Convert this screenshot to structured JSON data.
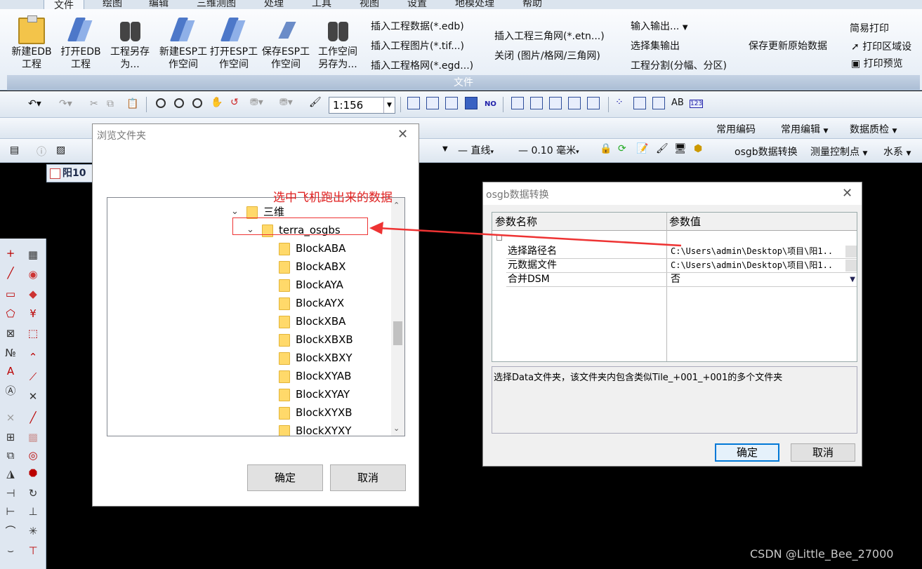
{
  "ribbon": {
    "tabs": [
      "文件",
      "绘图",
      "编辑",
      "三维测图",
      "处理",
      "工具",
      "视图",
      "设置",
      "地模处理",
      "帮助"
    ],
    "active_tab": "文件",
    "big_buttons": [
      {
        "label": "新建EDB\n工程",
        "icon": "clipboard-icon"
      },
      {
        "label": "打开EDB\n工程",
        "icon": "pen-icon"
      },
      {
        "label": "工程另存\n为...",
        "icon": "binoculars-icon"
      },
      {
        "label": "新建ESP工\n作空间",
        "icon": "pen-icon"
      },
      {
        "label": "打开ESP工\n作空间",
        "icon": "pen-icon"
      },
      {
        "label": "保存ESP工\n作空间",
        "icon": "arrow-icon"
      },
      {
        "label": "工作空间\n另存为...",
        "icon": "binoculars-icon"
      }
    ],
    "small_buttons": {
      "insert_edb": "插入工程数据(*.edb)",
      "insert_image": "插入工程图片(*.tif...)",
      "insert_grid": "插入工程格网(*.egd...)",
      "insert_tin": "插入工程三角网(*.etn...)",
      "close_tin": "关闭 (图片/格网/三角网)",
      "io": "输入输出...",
      "selset_out": "选择集输出",
      "split": "工程分割(分幅、分区)",
      "save_update": "保存更新原始数据",
      "simple_print": "简易打印",
      "print_area": "打印区域设",
      "print_preview": "打印预览"
    },
    "group_label": "文件"
  },
  "toolbar": {
    "scale": "1:156",
    "menus": [
      "常用编码",
      "常用编辑",
      "数据质检"
    ],
    "line_type": "直线",
    "line_width": "0.10 毫米",
    "osgb_convert": "osgb数据转换",
    "survey_point": "测量控制点",
    "water": "水系",
    "no_label": "NO",
    "ab_label": "AB",
    "num_label": "123"
  },
  "document": {
    "tab_label": "阳10"
  },
  "browse_dialog": {
    "title": "浏览文件夹",
    "tree": [
      {
        "label": "三维",
        "expanded": true
      },
      {
        "label": "terra_osgbs",
        "expanded": true
      },
      {
        "label": "BlockABA"
      },
      {
        "label": "BlockABX"
      },
      {
        "label": "BlockAYA"
      },
      {
        "label": "BlockAYX"
      },
      {
        "label": "BlockXBA"
      },
      {
        "label": "BlockXBXB"
      },
      {
        "label": "BlockXBXY"
      },
      {
        "label": "BlockXYAB"
      },
      {
        "label": "BlockXYAY"
      },
      {
        "label": "BlockXYXB"
      },
      {
        "label": "BlockXYXY"
      }
    ],
    "ok": "确定",
    "cancel": "取消"
  },
  "annotation": {
    "text": "选中飞机跑出来的数据",
    "color": "#e02020"
  },
  "osgb_dialog": {
    "title": "osgb数据转换",
    "col_name": "参数名称",
    "col_value": "参数值",
    "rows": [
      {
        "name": "选择路径名",
        "value": "C:\\Users\\admin\\Desktop\\项目\\阳1.."
      },
      {
        "name": "元数据文件",
        "value": "C:\\Users\\admin\\Desktop\\项目\\阳1.."
      },
      {
        "name": "合并DSM",
        "value": "否"
      }
    ],
    "description": "选择Data文件夹，该文件夹内包含类似Tile_+001_+001的多个文件夹",
    "ok": "确定",
    "cancel": "取消"
  },
  "watermark": "CSDN @Little_Bee_27000"
}
